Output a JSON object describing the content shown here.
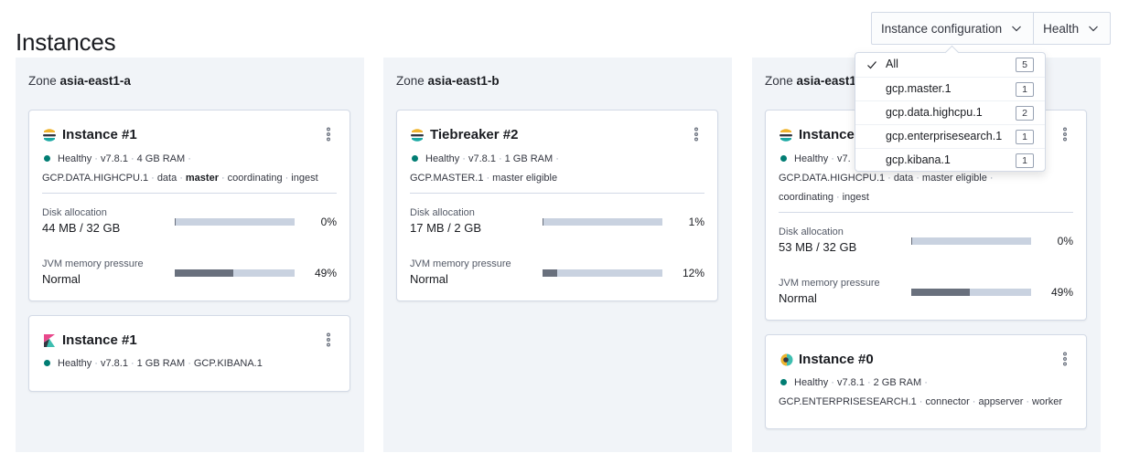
{
  "page": {
    "title": "Instances"
  },
  "filters": {
    "instance_config_label": "Instance configuration",
    "health_label": "Health"
  },
  "dropdown": {
    "items": [
      {
        "label": "All",
        "count": "5",
        "checked": true
      },
      {
        "label": "gcp.master.1",
        "count": "1",
        "checked": false
      },
      {
        "label": "gcp.data.highcpu.1",
        "count": "2",
        "checked": false
      },
      {
        "label": "gcp.enterprisesearch.1",
        "count": "1",
        "checked": false
      },
      {
        "label": "gcp.kibana.1",
        "count": "1",
        "checked": false
      }
    ]
  },
  "zones": [
    {
      "prefix": "Zone",
      "name": "asia-east1-a",
      "cards": [
        {
          "title": "Instance #1",
          "logo": "elasticsearch-logo-icon",
          "health": "Healthy",
          "version": "v7.8.1",
          "ram": "4 GB RAM",
          "config": "GCP.DATA.HIGHCPU.1",
          "roles": [
            "data",
            "master",
            "coordinating",
            "ingest"
          ],
          "disk_label": "Disk allocation",
          "disk_value": "44 MB / 32 GB",
          "disk_pct": "0%",
          "disk_fraction": 0.005,
          "jvm_label": "JVM memory pressure",
          "jvm_value": "Normal",
          "jvm_pct": "49%",
          "jvm_fraction": 0.49
        },
        {
          "title": "Instance #1",
          "logo": "kibana-logo-icon",
          "health": "Healthy",
          "version": "v7.8.1",
          "ram": "1 GB RAM",
          "config": "GCP.KIBANA.1"
        }
      ]
    },
    {
      "prefix": "Zone",
      "name": "asia-east1-b",
      "cards": [
        {
          "title": "Tiebreaker #2",
          "logo": "elasticsearch-logo-icon",
          "health": "Healthy",
          "version": "v7.8.1",
          "ram": "1 GB RAM",
          "config": "GCP.MASTER.1",
          "roles": [
            "master eligible"
          ],
          "disk_label": "Disk allocation",
          "disk_value": "17 MB / 2 GB",
          "disk_pct": "1%",
          "disk_fraction": 0.01,
          "jvm_label": "JVM memory pressure",
          "jvm_value": "Normal",
          "jvm_pct": "12%",
          "jvm_fraction": 0.12
        }
      ]
    },
    {
      "prefix": "Zone",
      "name": "asia-east1",
      "cards": [
        {
          "title": "Instance",
          "logo": "elasticsearch-logo-icon",
          "health": "Healthy",
          "version": "v7.",
          "config": "GCP.DATA.HIGHCPU.1",
          "roles": [
            "data",
            "master eligible",
            "coordinating",
            "ingest"
          ],
          "disk_label": "Disk allocation",
          "disk_value": "53 MB / 32 GB",
          "disk_pct": "0%",
          "disk_fraction": 0.005,
          "jvm_label": "JVM memory pressure",
          "jvm_value": "Normal",
          "jvm_pct": "49%",
          "jvm_fraction": 0.49
        },
        {
          "title": "Instance #0",
          "logo": "enterprise-search-logo-icon",
          "health": "Healthy",
          "version": "v7.8.1",
          "ram": "2 GB RAM",
          "config": "GCP.ENTERPRISESEARCH.1",
          "roles": [
            "connector",
            "appserver",
            "worker"
          ]
        }
      ]
    }
  ],
  "colors": {
    "healthy": "#017d73",
    "bar_track": "#c9d2e0",
    "bar_fill": "#69707d",
    "zone_bg": "#f1f4f8"
  }
}
